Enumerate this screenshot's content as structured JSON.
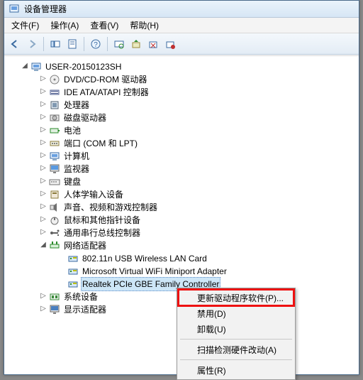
{
  "window": {
    "title": "设备管理器"
  },
  "menubar": {
    "file": "文件(F)",
    "action": "操作(A)",
    "view": "查看(V)",
    "help": "帮助(H)"
  },
  "toolbar_icons": [
    "back",
    "forward",
    "up",
    "view",
    "properties",
    "help",
    "refresh",
    "scan",
    "uninstall",
    "remove"
  ],
  "tree": {
    "root": "USER-20150123SH",
    "items": [
      "DVD/CD-ROM 驱动器",
      "IDE ATA/ATAPI 控制器",
      "处理器",
      "磁盘驱动器",
      "电池",
      "端口 (COM 和 LPT)",
      "计算机",
      "监视器",
      "键盘",
      "人体学输入设备",
      "声音、视频和游戏控制器",
      "鼠标和其他指针设备",
      "通用串行总线控制器"
    ],
    "net_category": "网络适配器",
    "net_children": [
      "802.11n USB Wireless LAN Card",
      "Microsoft Virtual WiFi Miniport Adapter",
      "Realtek PCIe GBE Family Controller"
    ],
    "tail": [
      "系统设备",
      "显示适配器"
    ]
  },
  "context_menu": {
    "update": "更新驱动程序软件(P)...",
    "disable": "禁用(D)",
    "uninstall": "卸载(U)",
    "scan": "扫描检测硬件改动(A)",
    "properties": "属性(R)"
  }
}
